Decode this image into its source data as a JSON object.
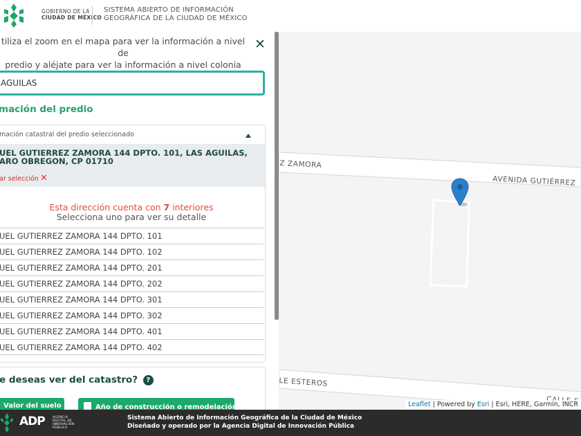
{
  "header": {
    "gov_line1": "GOBIERNO DE LA",
    "gov_line2": "CIUDAD DE MÉXICO",
    "system_line1": "SISTEMA ABIERTO DE INFORMACIÓN",
    "system_line2": "GEOGRÁFICA DE LA CIUDAD DE MÉXICO"
  },
  "sidebar": {
    "instructions_line1": "tiliza el zoom en el mapa para ver la información a nivel de",
    "instructions_line2": "predio y aléjate para ver la información a nivel colonia",
    "search_value": "AGUILAS",
    "section_title": "mación del predio",
    "card": {
      "header_label": "mación catastral del predio seleccionado",
      "address_line1": "UEL GUTIERREZ ZAMORA 144 DPTO. 101, LAS AGUILAS,",
      "address_line2": "ARO OBREGON, CP 01710",
      "clear_label": "ar selección",
      "interiors_prefix": "Esta dirección cuenta con ",
      "interiors_count": "7",
      "interiors_suffix": " interiores",
      "interiors_hint": "Selecciona uno para ver su detalle",
      "units": [
        "UEL GUTIERREZ ZAMORA 144 DPTO. 101",
        "UEL GUTIERREZ ZAMORA 144 DPTO. 102",
        "UEL GUTIERREZ ZAMORA 144 DPTO. 201",
        "UEL GUTIERREZ ZAMORA 144 DPTO. 202",
        "UEL GUTIERREZ ZAMORA 144 DPTO. 301",
        "UEL GUTIERREZ ZAMORA 144 DPTO. 302",
        "UEL GUTIERREZ ZAMORA 144 DPTO. 401",
        "UEL GUTIERREZ ZAMORA 144 DPTO. 402"
      ]
    },
    "catastro_question": "e deseas ver del catastro?",
    "btn_valor": "Valor del suelo",
    "btn_anio": "Año de construcción o remodelación"
  },
  "map": {
    "street_label_left": "EZ ZAMORA",
    "street_label_right": "AVENIDA GUTIÉRREZ",
    "street_lower_left": "LLE ESTEROS",
    "street_lower_right": "CALLE E",
    "attribution_leaflet": "Leaflet",
    "attribution_powered": " | Powered by ",
    "attribution_esri": "Esri",
    "attribution_rest": " | Esri, HERE, Garmin, INCR",
    "marker_color": "#2a81cb"
  },
  "footer": {
    "adip_mark": "ADP",
    "adip_sub1": "AGENCIA",
    "adip_sub2": "DIGITAL DE",
    "adip_sub3": "INNOVACIÓN",
    "adip_sub4": "PÚBLICA",
    "line1": "Sistema Abierto de Información Geográfica de la Ciudad de México",
    "line2": "Diseñado y operado por la Agencia Digital de Innovación Pública"
  },
  "colors": {
    "accent_teal": "#2cb0a1",
    "accent_green": "#2aa06b",
    "brand_dark": "#1b4e45",
    "alert_red": "#e04a40"
  }
}
